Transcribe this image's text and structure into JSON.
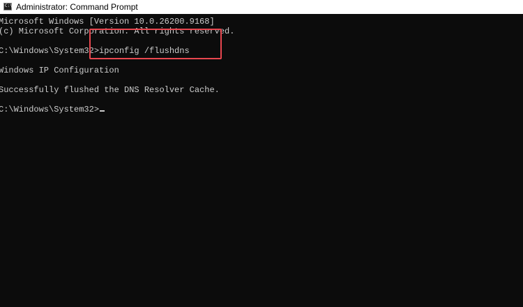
{
  "window": {
    "title": "Administrator: Command Prompt",
    "icon": "cmd-icon",
    "icon_glyph": "C:\\"
  },
  "console": {
    "lines": [
      "Microsoft Windows [Version 10.0.26200.9168]",
      "(c) Microsoft Corporation. All rights reserved.",
      "",
      "C:\\Windows\\System32>ipconfig /flushdns",
      "",
      "Windows IP Configuration",
      "",
      "Successfully flushed the DNS Resolver Cache.",
      "",
      "C:\\Windows\\System32>"
    ]
  },
  "highlight": {
    "color": "#e8474f"
  },
  "colors": {
    "console_background": "#0c0c0c",
    "console_text": "#cccccc",
    "titlebar_background": "#ffffff"
  }
}
